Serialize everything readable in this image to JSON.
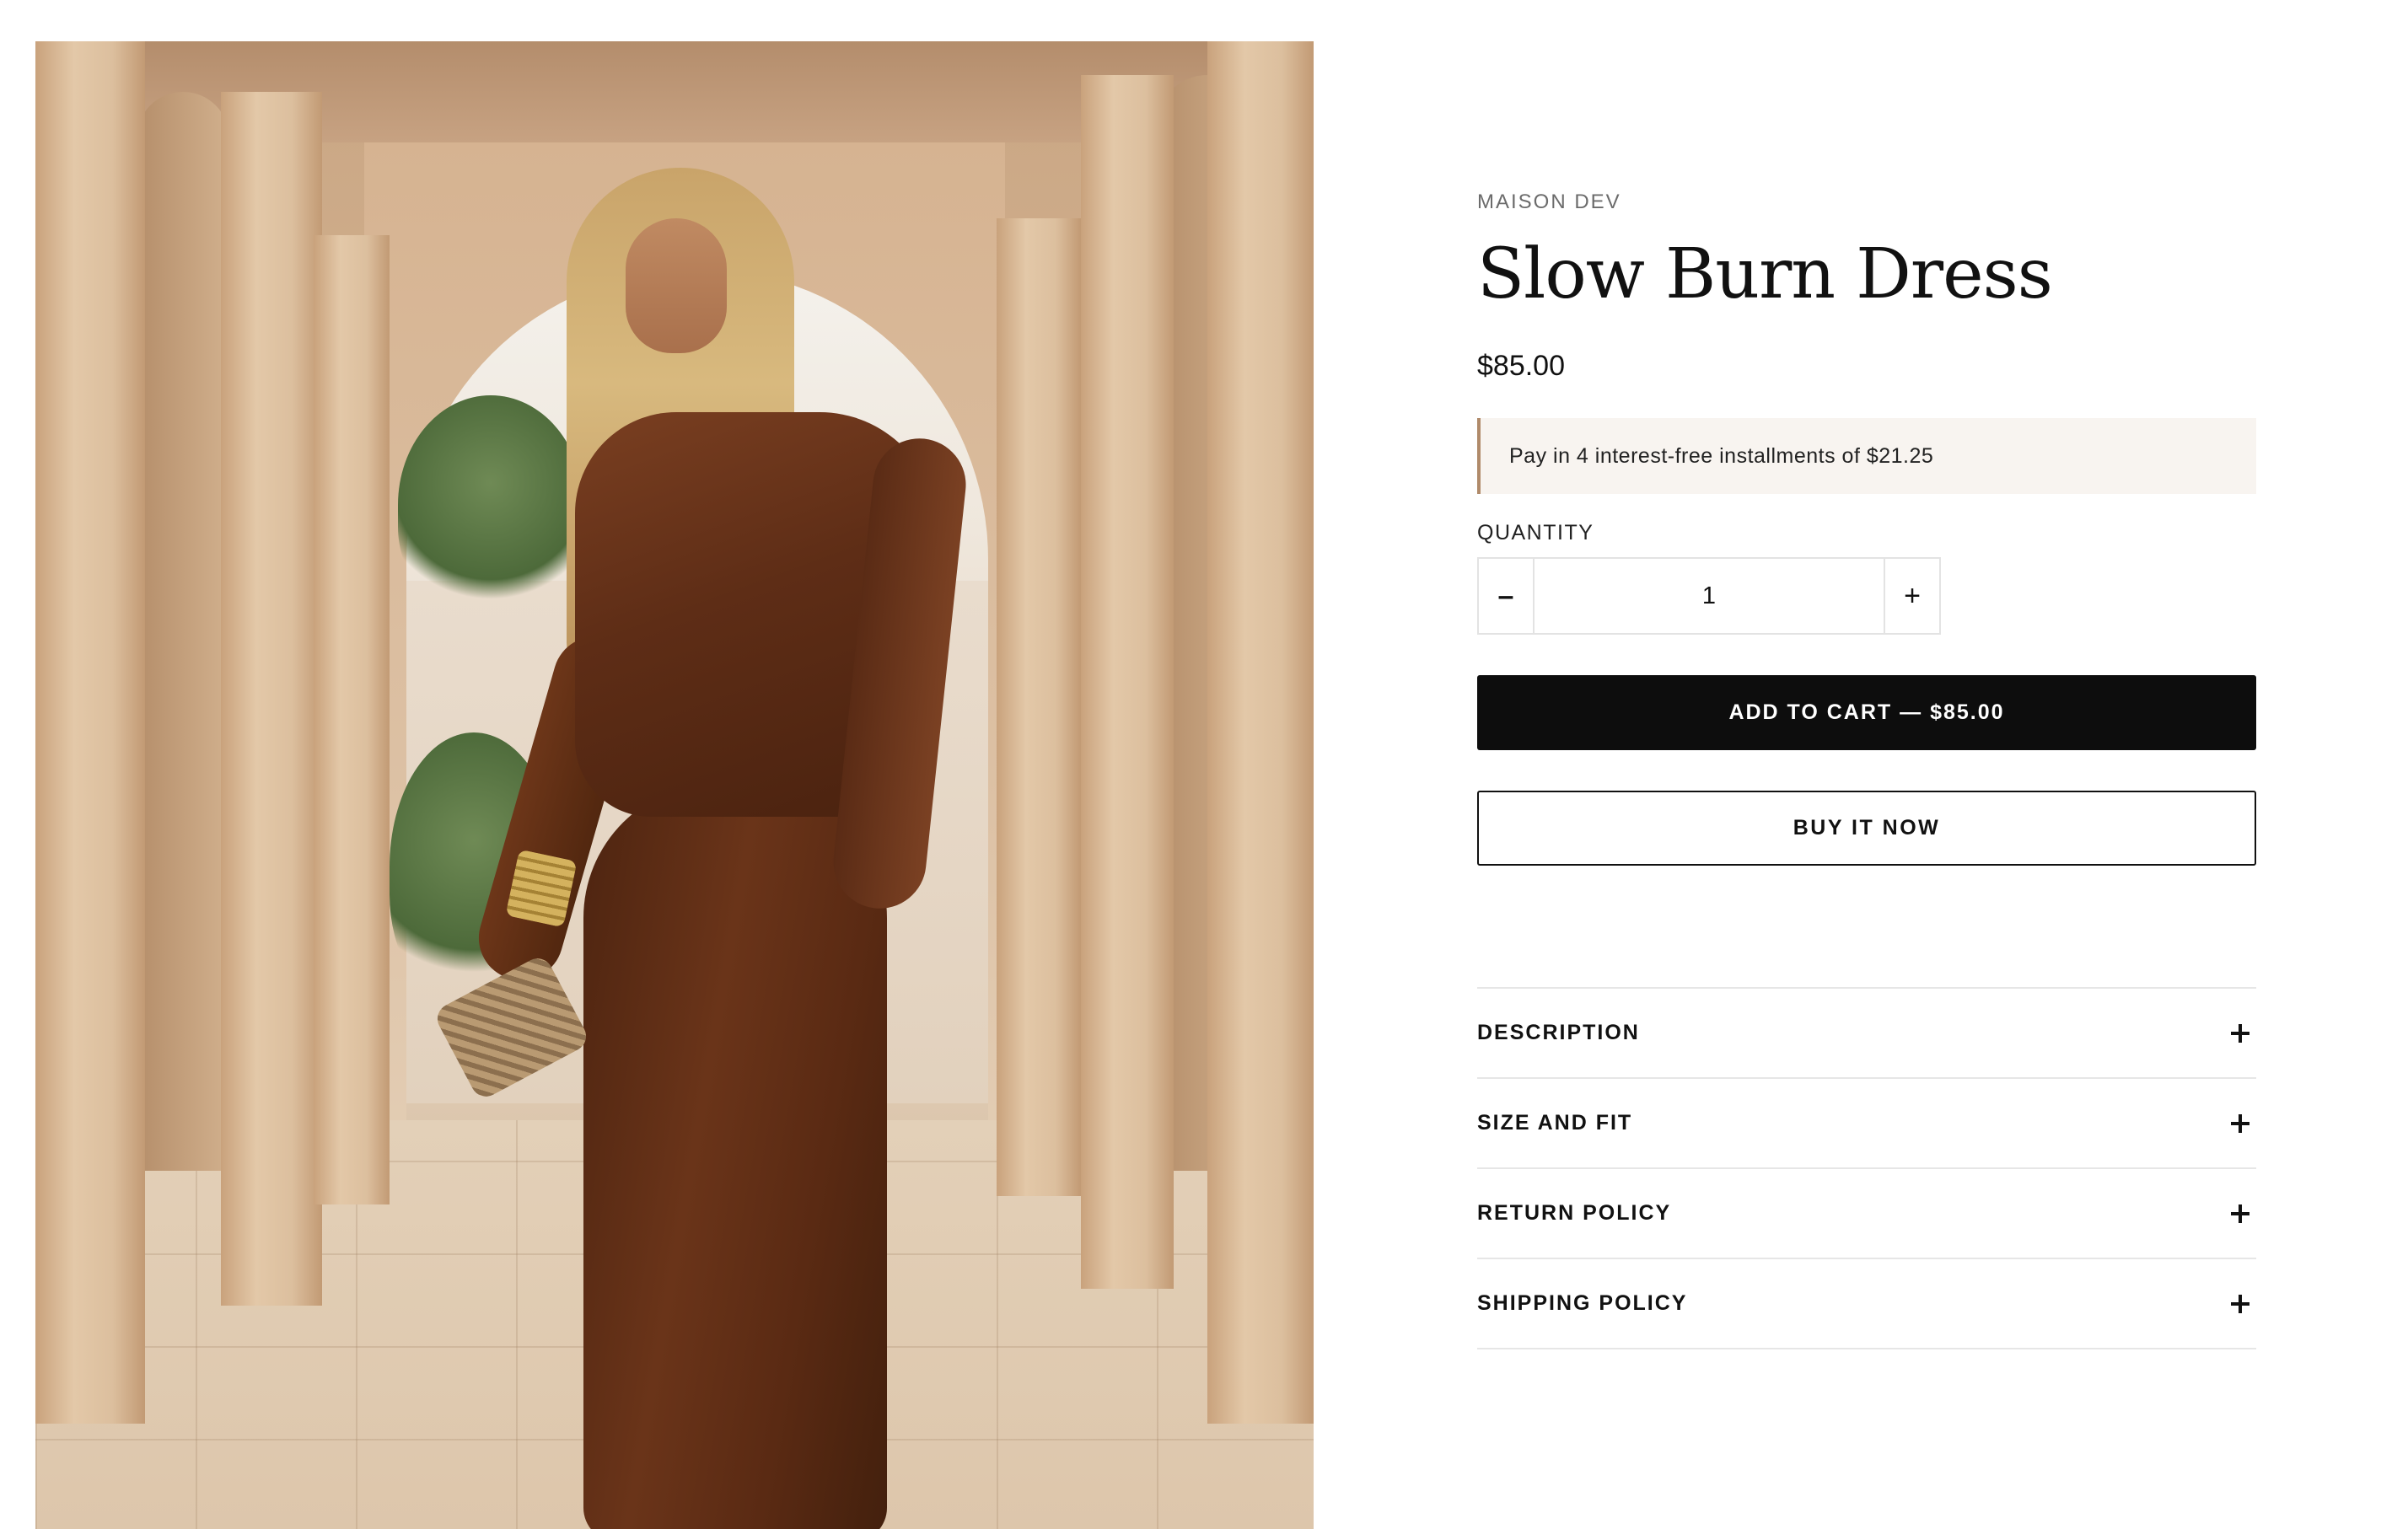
{
  "product": {
    "vendor": "MAISON DEV",
    "title": "Slow Burn Dress",
    "price": "$85.00",
    "installments_text": "Pay in 4 interest-free installments of $21.25",
    "image_alt": "Model in a long brown draped dress standing in a sandstone arched colonnade"
  },
  "quantity": {
    "label": "QUANTITY",
    "value": "1",
    "decrease_symbol": "–",
    "increase_symbol": "+"
  },
  "actions": {
    "add_to_cart": "ADD TO CART — $85.00",
    "buy_now": "BUY IT NOW"
  },
  "accordion": [
    {
      "label": "DESCRIPTION",
      "icon": "plus-icon"
    },
    {
      "label": "SIZE AND FIT",
      "icon": "plus-icon"
    },
    {
      "label": "RETURN POLICY",
      "icon": "plus-icon"
    },
    {
      "label": "SHIPPING POLICY",
      "icon": "plus-icon"
    }
  ],
  "colors": {
    "primary_button": "#0d0d0d",
    "installment_bg": "#f8f4f0",
    "installment_accent": "#b08a6a",
    "divider": "#e6e6e6"
  }
}
